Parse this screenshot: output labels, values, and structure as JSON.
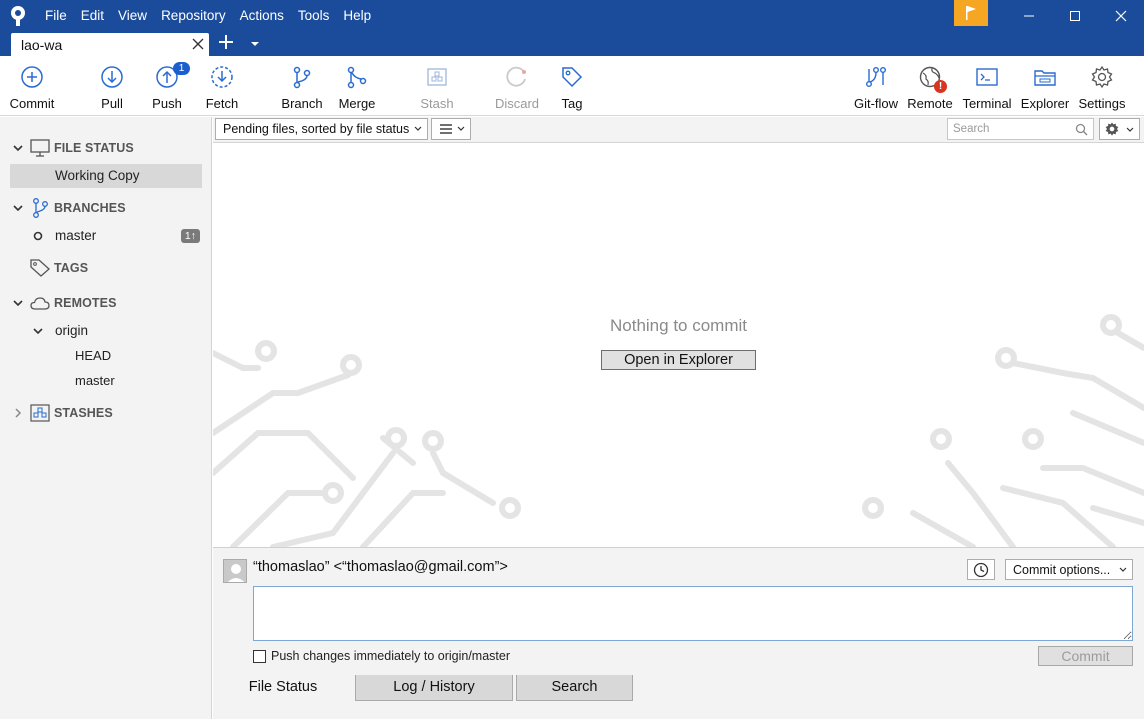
{
  "menu": [
    "File",
    "Edit",
    "View",
    "Repository",
    "Actions",
    "Tools",
    "Help"
  ],
  "tab": {
    "title": "lao-wa"
  },
  "toolbar": {
    "commit": "Commit",
    "pull": "Pull",
    "push": "Push",
    "push_badge": "1",
    "fetch": "Fetch",
    "branch": "Branch",
    "merge": "Merge",
    "stash": "Stash",
    "discard": "Discard",
    "tag": "Tag",
    "gitflow": "Git-flow",
    "remote": "Remote",
    "remote_badge": "!",
    "terminal": "Terminal",
    "explorer": "Explorer",
    "settings": "Settings"
  },
  "sidebar": {
    "file_status": "FILE STATUS",
    "working_copy": "Working Copy",
    "branches": "BRANCHES",
    "master": "master",
    "master_badge": "1↑",
    "tags": "TAGS",
    "remotes": "REMOTES",
    "origin": "origin",
    "head": "HEAD",
    "origin_master": "master",
    "stashes": "STASHES"
  },
  "filterbar": {
    "sort": "Pending files, sorted by file status",
    "search_placeholder": "Search"
  },
  "main": {
    "empty_message": "Nothing to commit",
    "open_button": "Open in Explorer"
  },
  "commit": {
    "author": "“thomaslao” <“thomaslao@gmail.com”>",
    "options": "Commit options...",
    "push_label": "Push changes immediately to origin/master",
    "commit_button": "Commit"
  },
  "bottom_tabs": [
    "File Status",
    "Log / History",
    "Search"
  ],
  "colors": {
    "titlebar": "#1b4c9c",
    "flag": "#f5a623",
    "accent": "#1b5fcf"
  }
}
